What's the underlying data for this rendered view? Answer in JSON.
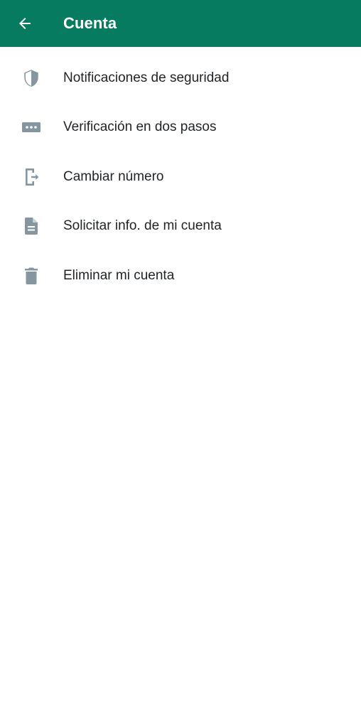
{
  "header": {
    "title": "Cuenta",
    "back_icon": "arrow-left-icon",
    "background_color": "#077b60"
  },
  "menu": {
    "items": [
      {
        "label": "Notificaciones de seguridad",
        "icon": "shield-icon"
      },
      {
        "label": "Verificación en dos pasos",
        "icon": "password-dots-icon"
      },
      {
        "label": "Cambiar número",
        "icon": "change-number-icon"
      },
      {
        "label": "Solicitar info. de mi cuenta",
        "icon": "document-icon"
      },
      {
        "label": "Eliminar mi cuenta",
        "icon": "trash-icon"
      }
    ],
    "icon_color": "#8696a0"
  }
}
